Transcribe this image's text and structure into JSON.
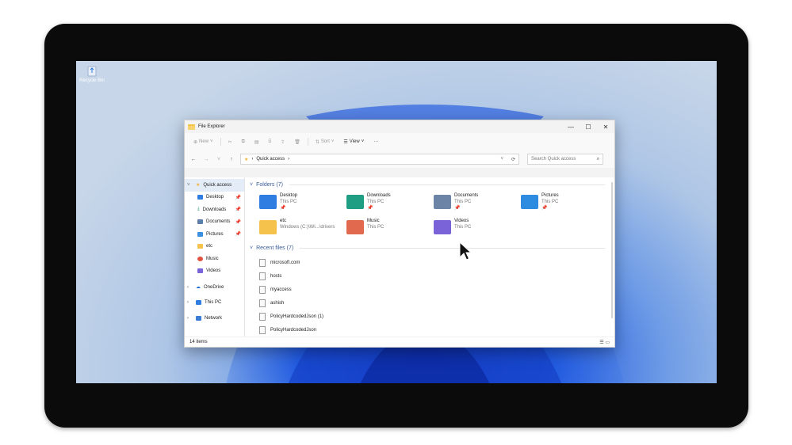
{
  "desktop": {
    "recycle_bin_label": "Recycle Bin"
  },
  "window": {
    "title": "File Explorer",
    "controls": {
      "minimize": "—",
      "maximize": "☐",
      "close": "✕"
    }
  },
  "toolbar": {
    "new_label": "New",
    "sort_label": "Sort",
    "view_label": "View",
    "more_label": "···"
  },
  "address": {
    "path": "Quick access",
    "search_placeholder": "Search Quick access"
  },
  "nav": {
    "items": [
      {
        "label": "Quick access",
        "icon": "star-icon",
        "color": "#f2b233",
        "pinned": false
      },
      {
        "label": "Desktop",
        "icon": "desktop-icon",
        "color": "#2f7de1",
        "pinned": true
      },
      {
        "label": "Downloads",
        "icon": "download-icon",
        "color": "#1f8a7a",
        "pinned": true
      },
      {
        "label": "Documents",
        "icon": "documents-icon",
        "color": "#5a7fa8",
        "pinned": true
      },
      {
        "label": "Pictures",
        "icon": "pictures-icon",
        "color": "#3a8fe0",
        "pinned": true
      },
      {
        "label": "etc",
        "icon": "folder-icon",
        "color": "#f5c24b",
        "pinned": false
      },
      {
        "label": "Music",
        "icon": "music-icon",
        "color": "#e0533e",
        "pinned": false
      },
      {
        "label": "Videos",
        "icon": "videos-icon",
        "color": "#7a62d8",
        "pinned": false
      },
      {
        "label": "OneDrive",
        "icon": "cloud-icon",
        "color": "#1e6fd9",
        "pinned": false
      },
      {
        "label": "This PC",
        "icon": "computer-icon",
        "color": "#2f7de1",
        "pinned": false
      },
      {
        "label": "Network",
        "icon": "network-icon",
        "color": "#3a7bd5",
        "pinned": false
      }
    ]
  },
  "folders_section": {
    "title": "Folders (7)",
    "items": [
      {
        "name": "Desktop",
        "sub": "This PC",
        "pinned": true,
        "color": "#2f7de1"
      },
      {
        "name": "Downloads",
        "sub": "This PC",
        "pinned": true,
        "color": "#1f9e83"
      },
      {
        "name": "Documents",
        "sub": "This PC",
        "pinned": true,
        "color": "#6c85a6"
      },
      {
        "name": "Pictures",
        "sub": "This PC",
        "pinned": true,
        "color": "#2d8be0"
      },
      {
        "name": "etc",
        "sub": "Windows (C:)\\Wi...\\drivers",
        "pinned": false,
        "color": "#f5c24b"
      },
      {
        "name": "Music",
        "sub": "This PC",
        "pinned": false,
        "color": "#e0694e"
      },
      {
        "name": "Videos",
        "sub": "This PC",
        "pinned": false,
        "color": "#7a62d8"
      }
    ]
  },
  "recent_section": {
    "title": "Recent files (7)",
    "files": [
      "microsoft.com",
      "hosts",
      "myaccess",
      "ashish",
      "PolicyHardcodedJson (1)",
      "PolicyHardcodedJson"
    ]
  },
  "status": {
    "items_count": "14 items"
  }
}
